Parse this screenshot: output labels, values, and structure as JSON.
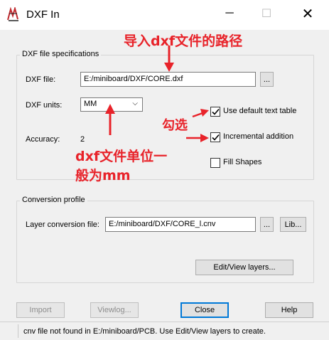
{
  "window": {
    "title": "DXF In",
    "minimize_glyph": "─",
    "maximize_glyph": "☐",
    "close_glyph": "✕"
  },
  "dxf_specs": {
    "group_label": "DXF file specifications",
    "file_label": "DXF file:",
    "file_value": "E:/miniboard/DXF/CORE.dxf",
    "browse_label": "...",
    "units_label": "DXF units:",
    "units_value": "MM",
    "accuracy_label": "Accuracy:",
    "accuracy_value": "2",
    "opt_default_text": "Use default text table",
    "opt_default_text_checked": true,
    "opt_incremental": "Incremental addition",
    "opt_incremental_checked": true,
    "opt_fill": "Fill Shapes",
    "opt_fill_checked": false
  },
  "conversion": {
    "group_label": "Conversion profile",
    "layer_label": "Layer conversion file:",
    "layer_value": "E:/miniboard/DXF/CORE_l.cnv",
    "browse_label": "...",
    "lib_label": "Lib...",
    "edit_layers_label": "Edit/View layers..."
  },
  "buttons": {
    "import": "Import",
    "viewlog": "Viewlog...",
    "close": "Close",
    "help": "Help"
  },
  "status": {
    "text": "cnv file not found in E:/miniboard/PCB. Use Edit/View layers to create."
  },
  "annotations": {
    "path_note": "导入dxf文件的路径",
    "check_note": "勾选",
    "unit_note_line1": "dxf文件单位一",
    "unit_note_line2": "般为mm",
    "color": "#e8232a"
  }
}
